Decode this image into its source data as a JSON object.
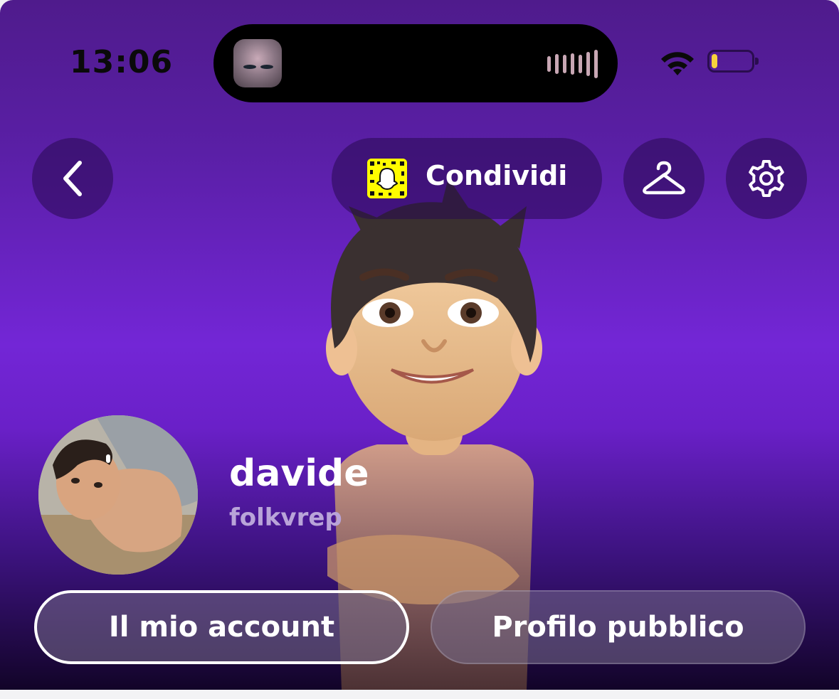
{
  "status_bar": {
    "time": "13:06"
  },
  "header": {
    "share_label": "Condividi"
  },
  "profile": {
    "display_name": "davide",
    "username": "folkvrep"
  },
  "actions": {
    "my_account_label": "Il mio account",
    "public_profile_label": "Profilo pubblico"
  },
  "icons": {
    "back": "chevron-left-icon",
    "snapcode": "snapcode-icon",
    "hanger": "hanger-icon",
    "settings": "gear-icon",
    "wifi": "wifi-icon",
    "battery": "battery-icon"
  },
  "battery_level": 0.15,
  "colors": {
    "accent_purple": "#7326d6",
    "snap_yellow": "#fffc00",
    "battery_yellow": "#f7d23c"
  }
}
